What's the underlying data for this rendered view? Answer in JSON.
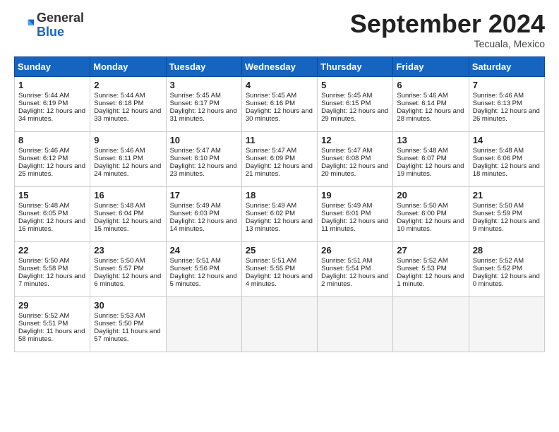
{
  "logo": {
    "line1": "General",
    "line2": "Blue"
  },
  "title": "September 2024",
  "subtitle": "Tecuala, Mexico",
  "headers": [
    "Sunday",
    "Monday",
    "Tuesday",
    "Wednesday",
    "Thursday",
    "Friday",
    "Saturday"
  ],
  "weeks": [
    [
      {
        "day": "1",
        "sunrise": "Sunrise: 5:44 AM",
        "sunset": "Sunset: 6:19 PM",
        "daylight": "Daylight: 12 hours and 34 minutes."
      },
      {
        "day": "2",
        "sunrise": "Sunrise: 5:44 AM",
        "sunset": "Sunset: 6:18 PM",
        "daylight": "Daylight: 12 hours and 33 minutes."
      },
      {
        "day": "3",
        "sunrise": "Sunrise: 5:45 AM",
        "sunset": "Sunset: 6:17 PM",
        "daylight": "Daylight: 12 hours and 31 minutes."
      },
      {
        "day": "4",
        "sunrise": "Sunrise: 5:45 AM",
        "sunset": "Sunset: 6:16 PM",
        "daylight": "Daylight: 12 hours and 30 minutes."
      },
      {
        "day": "5",
        "sunrise": "Sunrise: 5:45 AM",
        "sunset": "Sunset: 6:15 PM",
        "daylight": "Daylight: 12 hours and 29 minutes."
      },
      {
        "day": "6",
        "sunrise": "Sunrise: 5:46 AM",
        "sunset": "Sunset: 6:14 PM",
        "daylight": "Daylight: 12 hours and 28 minutes."
      },
      {
        "day": "7",
        "sunrise": "Sunrise: 5:46 AM",
        "sunset": "Sunset: 6:13 PM",
        "daylight": "Daylight: 12 hours and 26 minutes."
      }
    ],
    [
      {
        "day": "8",
        "sunrise": "Sunrise: 5:46 AM",
        "sunset": "Sunset: 6:12 PM",
        "daylight": "Daylight: 12 hours and 25 minutes."
      },
      {
        "day": "9",
        "sunrise": "Sunrise: 5:46 AM",
        "sunset": "Sunset: 6:11 PM",
        "daylight": "Daylight: 12 hours and 24 minutes."
      },
      {
        "day": "10",
        "sunrise": "Sunrise: 5:47 AM",
        "sunset": "Sunset: 6:10 PM",
        "daylight": "Daylight: 12 hours and 23 minutes."
      },
      {
        "day": "11",
        "sunrise": "Sunrise: 5:47 AM",
        "sunset": "Sunset: 6:09 PM",
        "daylight": "Daylight: 12 hours and 21 minutes."
      },
      {
        "day": "12",
        "sunrise": "Sunrise: 5:47 AM",
        "sunset": "Sunset: 6:08 PM",
        "daylight": "Daylight: 12 hours and 20 minutes."
      },
      {
        "day": "13",
        "sunrise": "Sunrise: 5:48 AM",
        "sunset": "Sunset: 6:07 PM",
        "daylight": "Daylight: 12 hours and 19 minutes."
      },
      {
        "day": "14",
        "sunrise": "Sunrise: 5:48 AM",
        "sunset": "Sunset: 6:06 PM",
        "daylight": "Daylight: 12 hours and 18 minutes."
      }
    ],
    [
      {
        "day": "15",
        "sunrise": "Sunrise: 5:48 AM",
        "sunset": "Sunset: 6:05 PM",
        "daylight": "Daylight: 12 hours and 16 minutes."
      },
      {
        "day": "16",
        "sunrise": "Sunrise: 5:48 AM",
        "sunset": "Sunset: 6:04 PM",
        "daylight": "Daylight: 12 hours and 15 minutes."
      },
      {
        "day": "17",
        "sunrise": "Sunrise: 5:49 AM",
        "sunset": "Sunset: 6:03 PM",
        "daylight": "Daylight: 12 hours and 14 minutes."
      },
      {
        "day": "18",
        "sunrise": "Sunrise: 5:49 AM",
        "sunset": "Sunset: 6:02 PM",
        "daylight": "Daylight: 12 hours and 13 minutes."
      },
      {
        "day": "19",
        "sunrise": "Sunrise: 5:49 AM",
        "sunset": "Sunset: 6:01 PM",
        "daylight": "Daylight: 12 hours and 11 minutes."
      },
      {
        "day": "20",
        "sunrise": "Sunrise: 5:50 AM",
        "sunset": "Sunset: 6:00 PM",
        "daylight": "Daylight: 12 hours and 10 minutes."
      },
      {
        "day": "21",
        "sunrise": "Sunrise: 5:50 AM",
        "sunset": "Sunset: 5:59 PM",
        "daylight": "Daylight: 12 hours and 9 minutes."
      }
    ],
    [
      {
        "day": "22",
        "sunrise": "Sunrise: 5:50 AM",
        "sunset": "Sunset: 5:58 PM",
        "daylight": "Daylight: 12 hours and 7 minutes."
      },
      {
        "day": "23",
        "sunrise": "Sunrise: 5:50 AM",
        "sunset": "Sunset: 5:57 PM",
        "daylight": "Daylight: 12 hours and 6 minutes."
      },
      {
        "day": "24",
        "sunrise": "Sunrise: 5:51 AM",
        "sunset": "Sunset: 5:56 PM",
        "daylight": "Daylight: 12 hours and 5 minutes."
      },
      {
        "day": "25",
        "sunrise": "Sunrise: 5:51 AM",
        "sunset": "Sunset: 5:55 PM",
        "daylight": "Daylight: 12 hours and 4 minutes."
      },
      {
        "day": "26",
        "sunrise": "Sunrise: 5:51 AM",
        "sunset": "Sunset: 5:54 PM",
        "daylight": "Daylight: 12 hours and 2 minutes."
      },
      {
        "day": "27",
        "sunrise": "Sunrise: 5:52 AM",
        "sunset": "Sunset: 5:53 PM",
        "daylight": "Daylight: 12 hours and 1 minute."
      },
      {
        "day": "28",
        "sunrise": "Sunrise: 5:52 AM",
        "sunset": "Sunset: 5:52 PM",
        "daylight": "Daylight: 12 hours and 0 minutes."
      }
    ],
    [
      {
        "day": "29",
        "sunrise": "Sunrise: 5:52 AM",
        "sunset": "Sunset: 5:51 PM",
        "daylight": "Daylight: 11 hours and 58 minutes."
      },
      {
        "day": "30",
        "sunrise": "Sunrise: 5:53 AM",
        "sunset": "Sunset: 5:50 PM",
        "daylight": "Daylight: 11 hours and 57 minutes."
      },
      null,
      null,
      null,
      null,
      null
    ]
  ]
}
